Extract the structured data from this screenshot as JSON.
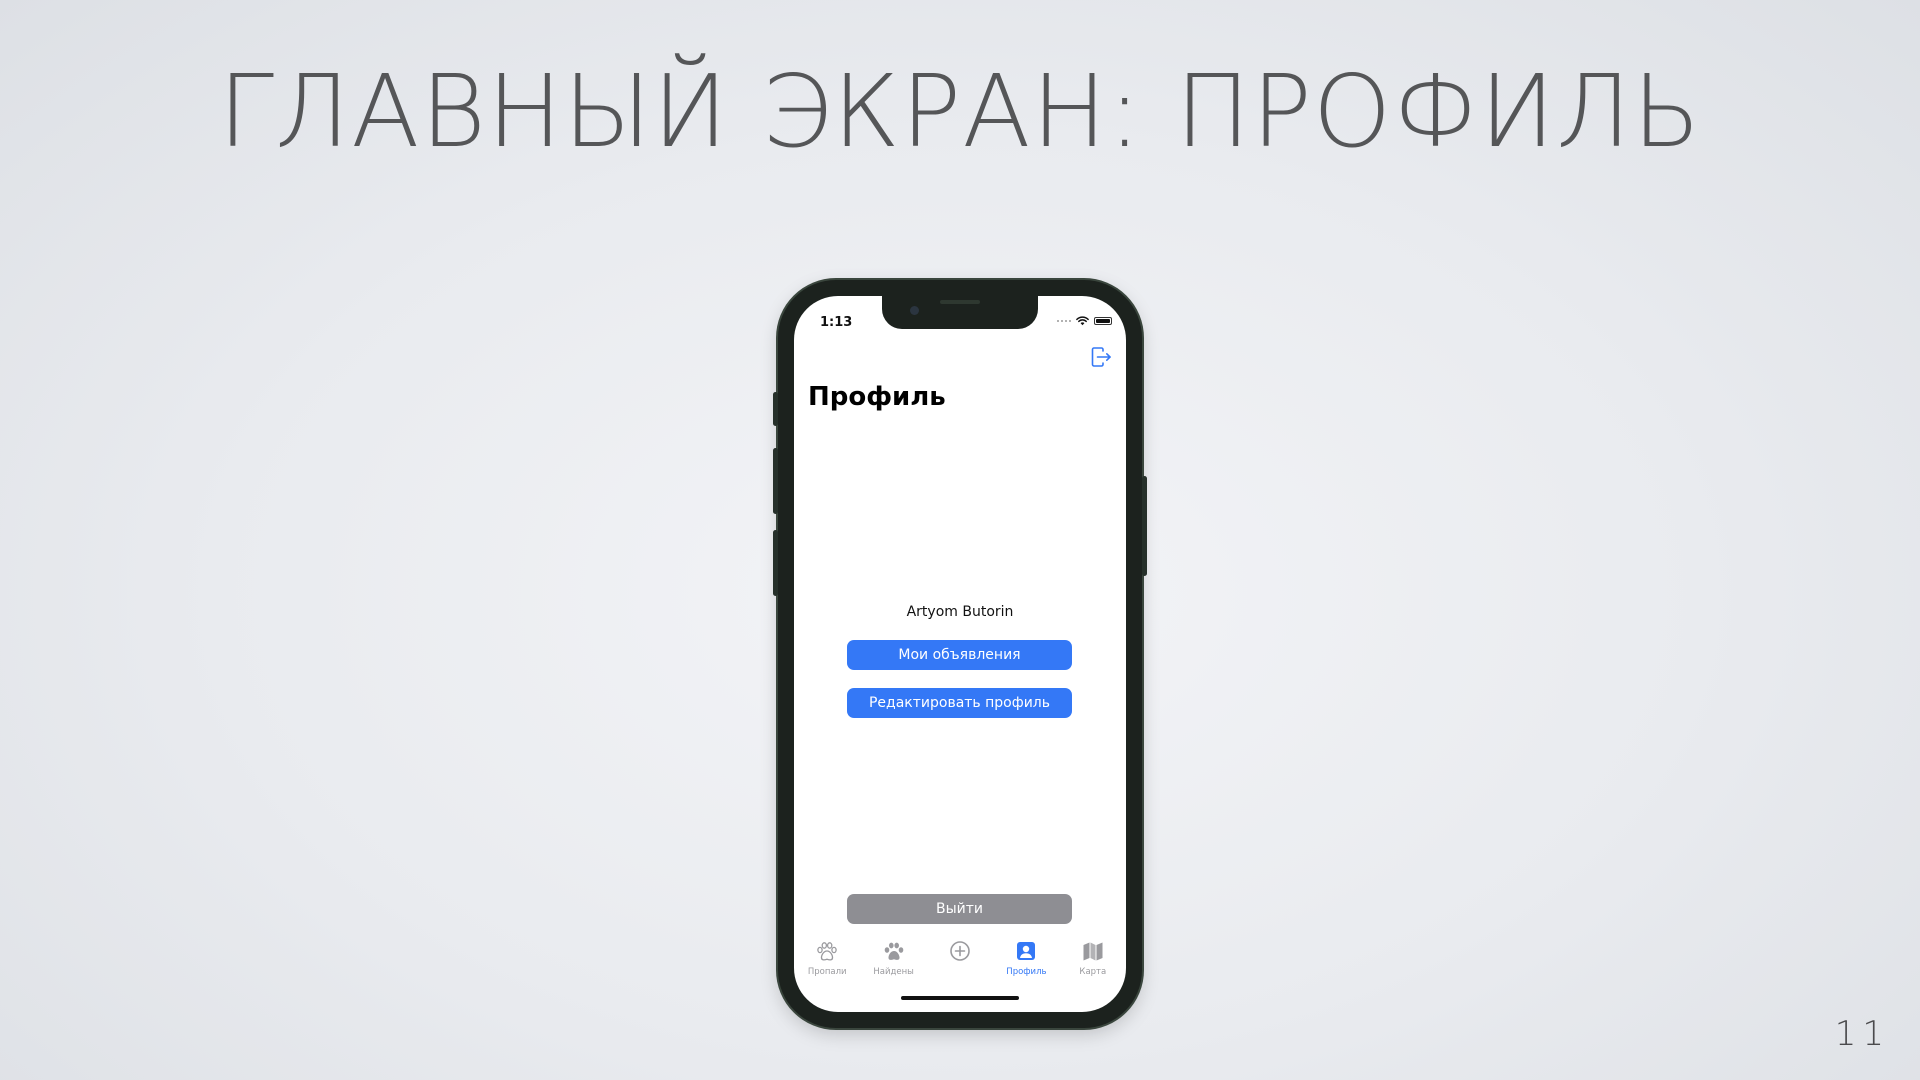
{
  "slide": {
    "title": "ГЛАВНЫЙ ЭКРАН: ПРОФИЛЬ",
    "page_number": "11"
  },
  "status_bar": {
    "time": "1:13",
    "icons": [
      "signal-dots-icon",
      "wifi-icon",
      "battery-icon"
    ]
  },
  "nav": {
    "logout_icon": "logout-icon"
  },
  "profile": {
    "title": "Профиль",
    "user_name": "Artyom Butorin",
    "my_ads_button": "Мои объявления",
    "edit_profile_button": "Редактировать профиль",
    "logout_button": "Выйти"
  },
  "tabbar": {
    "tabs": [
      {
        "label": "Пропали",
        "icon": "paw-outline-icon",
        "active": false
      },
      {
        "label": "Найдены",
        "icon": "paw-filled-icon",
        "active": false
      },
      {
        "label": "",
        "icon": "add-circle-icon",
        "active": false
      },
      {
        "label": "Профиль",
        "icon": "person-square-icon",
        "active": true
      },
      {
        "label": "Карта",
        "icon": "map-icon",
        "active": false
      }
    ]
  },
  "colors": {
    "accent": "#3478f6",
    "tab_inactive": "#9a9a9e",
    "logout_button": "#8e8e93",
    "title_text": "#555658"
  }
}
